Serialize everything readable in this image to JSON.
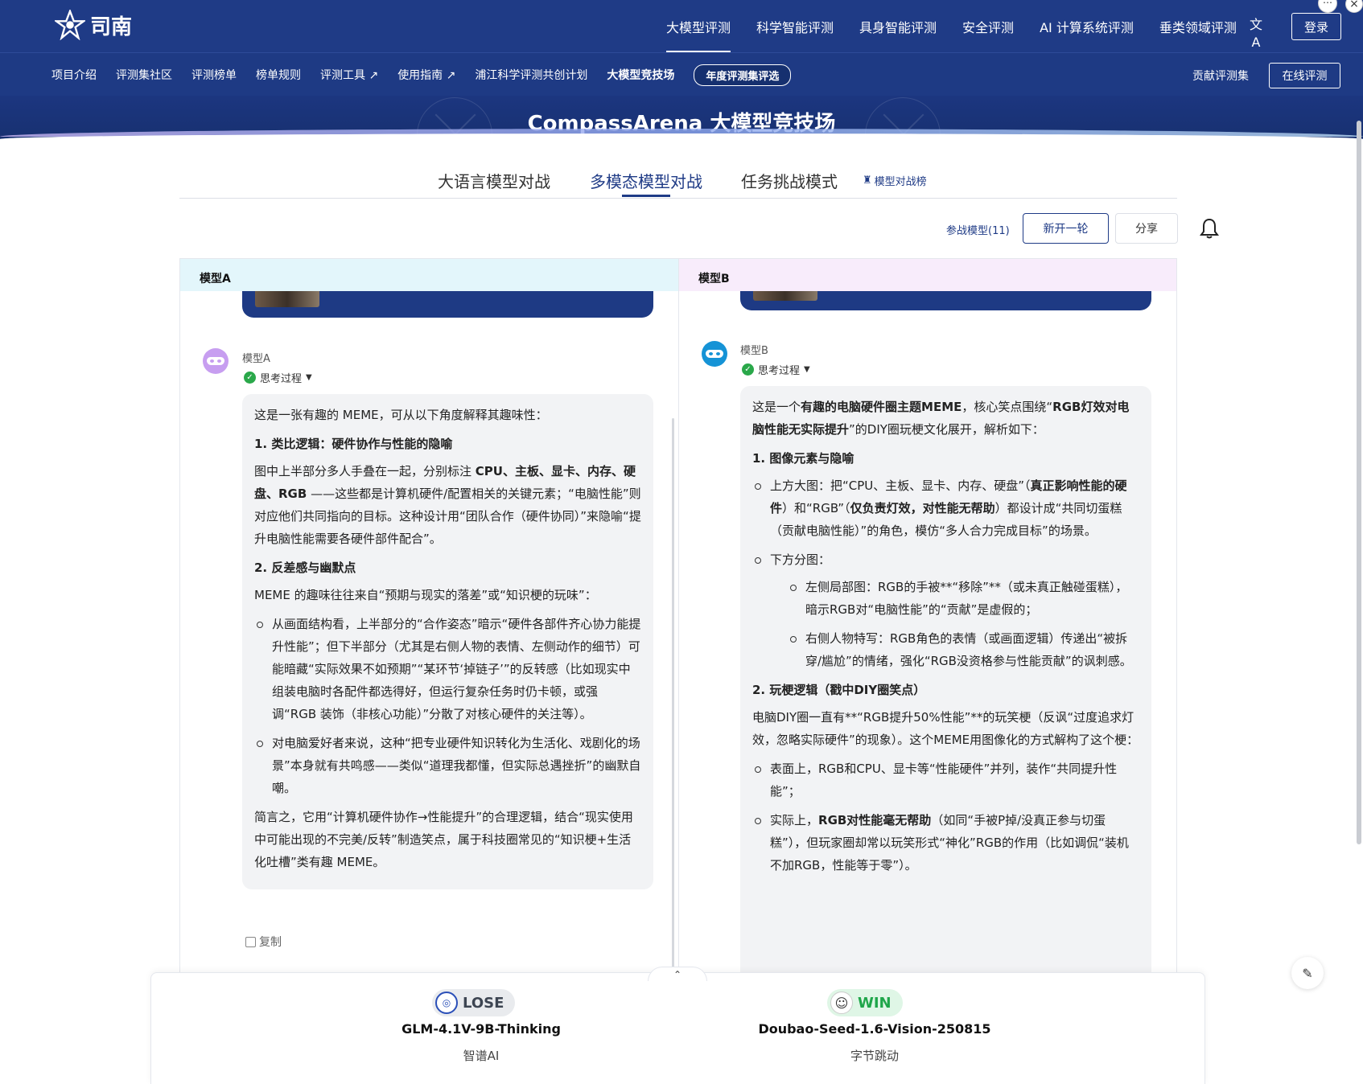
{
  "topnav": {
    "logo_text": "司南",
    "items": [
      "大模型评测",
      "科学智能评测",
      "具身智能评测",
      "安全评测",
      "AI 计算系统评测",
      "垂类领域评测"
    ],
    "active_index": 0,
    "login": "登录",
    "lang_icon": "translate-icon"
  },
  "subnav": {
    "items": [
      "项目介绍",
      "评测集社区",
      "评测榜单",
      "榜单规则",
      "评测工具 ↗",
      "使用指南 ↗",
      "浦江科学评测共创计划",
      "大模型竞技场"
    ],
    "pill": "年度评测集评选",
    "contribute": "贡献评测集",
    "online": "在线评测"
  },
  "banner": {
    "title": "CompassArena 大模型竞技场"
  },
  "tabs": {
    "items": [
      "大语言模型对战",
      "多模态模型对战",
      "任务挑战模式"
    ],
    "active_index": 1,
    "rank_link": "模型对战榜"
  },
  "actions": {
    "participants": "参战模型(11)",
    "new_round": "新开一轮",
    "share": "分享"
  },
  "panel_a": {
    "header": "模型A",
    "model_label": "模型A",
    "thinking": "思考过程",
    "copy": "复制",
    "p1": "这是一张有趣的 MEME，可从以下角度解释其趣味性：",
    "h1": "1. 类比逻辑：硬件协作与性能的隐喻",
    "p2a": "图中上半部分多人手叠在一起，分别标注 ",
    "p2b": "CPU、主板、显卡、内存、硬盘、RGB",
    "p2c": " ——这些都是计算机硬件/配置相关的关键元素；“电脑性能”则对应他们共同指向的目标。这种设计用“团队合作（硬件协同）”来隐喻“提升电脑性能需要各硬件部件配合”。",
    "h2": "2. 反差感与幽默点",
    "p3": "MEME 的趣味往往来自“预期与现实的落差”或“知识梗的玩味”：",
    "li1": "从画面结构看，上半部分的“合作姿态”暗示“硬件各部件齐心协力能提升性能”；但下半部分（尤其是右侧人物的表情、左侧动作的细节）可能暗藏“实际效果不如预期”“某环节‘掉链子’”的反转感（比如现实中组装电脑时各配件都选得好，但运行复杂任务时仍卡顿，或强调“RGB 装饰（非核心功能）”分散了对核心硬件的关注等）。",
    "li2": "对电脑爱好者来说，这种“把专业硬件知识转化为生活化、戏剧化的场景”本身就有共鸣感——类似“道理我都懂，但实际总遇挫折”的幽默自嘲。",
    "p4": "简言之，它用“计算机硬件协作→性能提升”的合理逻辑，结合“现实使用中可能出现的不完美/反转”制造笑点，属于科技圈常见的“知识梗+生活化吐槽”类有趣 MEME。"
  },
  "panel_b": {
    "header": "模型B",
    "model_label": "模型B",
    "thinking": "思考过程",
    "p1a": "这是一个",
    "p1b": "有趣的电脑硬件圈主题MEME",
    "p1c": "，核心笑点围绕“",
    "p1d": "RGB灯效对电脑性能无实际提升",
    "p1e": "”的DIY圈玩梗文化展开，解析如下：",
    "h1": "1. 图像元素与隐喻",
    "li1a": "上方大图：把“CPU、主板、显卡、内存、硬盘”（",
    "li1b": "真正影响性能的硬件",
    "li1c": "）和“RGB”（",
    "li1d": "仅负责灯效，对性能无帮助",
    "li1e": "）都设计成“共同切蛋糕（贡献电脑性能）”的角色，模仿“多人合力完成目标”的场景。",
    "li2": "下方分图：",
    "sub1": "左侧局部图：RGB的手被**“移除”**（或未真正触碰蛋糕），暗示RGB对“电脑性能”的“贡献”是虚假的；",
    "sub2": "右侧人物特写：RGB角色的表情（或画面逻辑）传递出“被拆穿/尴尬”的情绪，强化“RGB没资格参与性能贡献”的讽刺感。",
    "h2": "2. 玩梗逻辑（戳中DIY圈笑点）",
    "p2": "电脑DIY圈一直有**“RGB提升50%性能”**的玩笑梗（反讽“过度追求灯效，忽略实际硬件”的现象）。这个MEME用图像化的方式解构了这个梗：",
    "li3": "表面上，RGB和CPU、显卡等“性能硬件”并列，装作“共同提升性能”；",
    "li4a": "实际上，",
    "li4b": "RGB对性能毫无帮助",
    "li4c": "（如同“手被P掉/没真正参与切蛋糕”），但玩家圈却常以玩笑形式“神化”RGB的作用（比如调侃“装机不加RGB，性能等于零”）。"
  },
  "result": {
    "a_badge": "LOSE",
    "a_model": "GLM-4.1V-9B-Thinking",
    "a_org": "智谱AI",
    "b_badge": "WIN",
    "b_model": "Doubao-Seed-1.6-Vision-250815",
    "b_org": "字节跳动"
  },
  "colors": {
    "nav_bg": "#1f3b86",
    "win_green": "#1fa64a",
    "lose_gray": "#3d4552"
  }
}
